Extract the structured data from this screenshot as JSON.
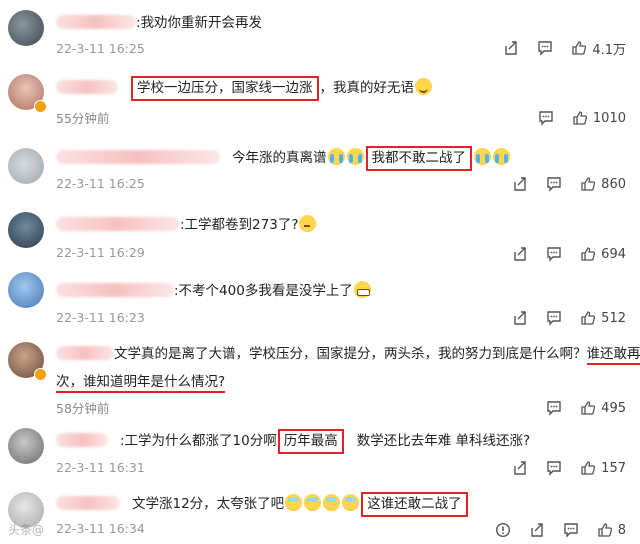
{
  "comments": [
    {
      "text": ":我劝你重新开会再发",
      "date": "22-3-11 16:25",
      "likes": "4.1万",
      "icons": [
        "share-icon",
        "comment-icon",
        "like-icon"
      ]
    },
    {
      "boxed": "学校一边压分，国家线一边涨",
      "sep": "，",
      "after": "我真的好无语",
      "date": "55分钟前",
      "likes": "1010",
      "icons": [
        "comment-icon",
        "like-icon"
      ]
    },
    {
      "before": "今年涨的真离谱",
      "boxed": "我都不敢二战了",
      "date": "22-3-11 16:25",
      "likes": "860",
      "icons": [
        "share-icon",
        "comment-icon",
        "like-icon"
      ]
    },
    {
      "text": ":工学都卷到273了?",
      "date": "22-3-11 16:29",
      "likes": "694",
      "icons": [
        "share-icon",
        "comment-icon",
        "like-icon"
      ]
    },
    {
      "text": ":不考个400多我看是没学上了",
      "date": "22-3-11 16:23",
      "likes": "512",
      "icons": [
        "share-icon",
        "comment-icon",
        "like-icon"
      ]
    },
    {
      "line1": "文学真的是离了大谱，学校压分，国家提分，两头杀，我的努力到底是什么啊？",
      "line1_underlined": "谁还敢再来一",
      "line2_underlined": "次，谁知道明年是什么情况?",
      "date": "58分钟前",
      "likes": "495",
      "icons": [
        "comment-icon",
        "like-icon"
      ]
    },
    {
      "before": ":工学为什么都涨了10分啊",
      "boxed": "历年最高",
      "after": "数学还比去年难 单科线还涨?",
      "date": "22-3-11 16:31",
      "likes": "157",
      "icons": [
        "share-icon",
        "comment-icon",
        "like-icon"
      ]
    },
    {
      "before": "文学涨12分，太夸张了吧",
      "boxed": "这谁还敢二战了",
      "date": "22-3-11 16:34",
      "likes": "8",
      "icons": [
        "report-icon",
        "share-icon",
        "comment-icon",
        "like-icon"
      ]
    }
  ],
  "colors": {
    "highlight": "#e0232b",
    "meta": "#999999",
    "vip_badge": "#f2a20d"
  },
  "watermark": "头条@"
}
